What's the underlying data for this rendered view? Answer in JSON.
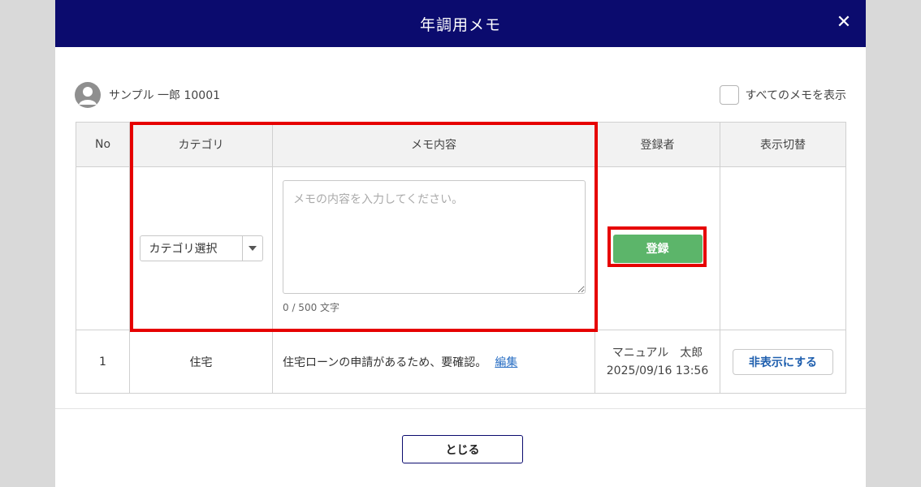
{
  "header": {
    "title": "年調用メモ",
    "close_icon": "close-icon"
  },
  "user": {
    "name": "サンプル 一郎 10001",
    "avatar_icon": "user-avatar-icon"
  },
  "show_all": {
    "label": "すべてのメモを表示",
    "checked": false
  },
  "table": {
    "headers": [
      "No",
      "カテゴリ",
      "メモ内容",
      "登録者",
      "表示切替"
    ],
    "input_row": {
      "category_select": {
        "value": "カテゴリ選択"
      },
      "memo_placeholder": "メモの内容を入力してください。",
      "char_count": "0 / 500 文字",
      "register_label": "登録"
    },
    "rows": [
      {
        "no": "1",
        "category": "住宅",
        "memo": "住宅ローンの申請があるため、要確認。",
        "edit_label": "編集",
        "registrar": "マニュアル　太郎",
        "timestamp": "2025/09/16 13:56",
        "toggle_label": "非表示にする"
      }
    ]
  },
  "footer": {
    "close_label": "とじる"
  },
  "colors": {
    "header_bg": "#0b0b6e",
    "register_btn": "#5cb56a",
    "highlight": "#e60000",
    "link": "#2a6fc4"
  }
}
